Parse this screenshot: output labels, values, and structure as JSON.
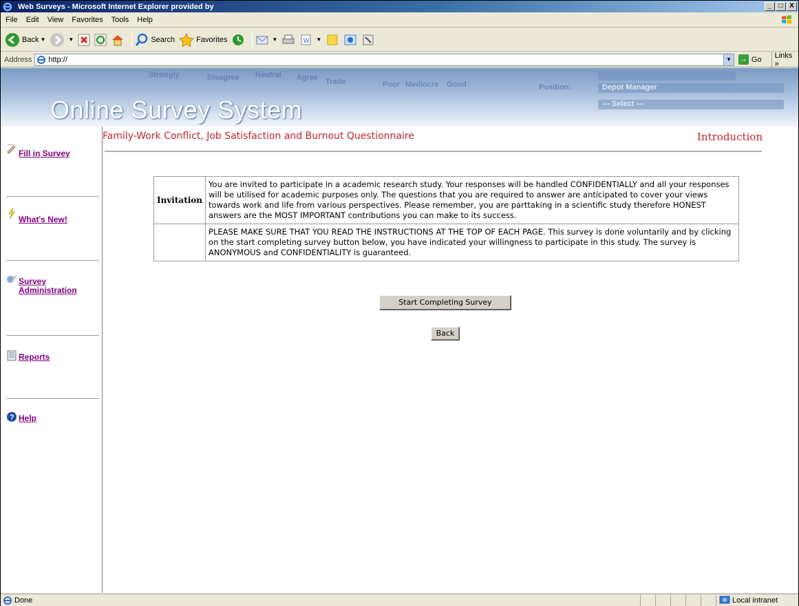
{
  "window": {
    "title": "Web Surveys - Microsoft Internet Explorer provided by",
    "controls": [
      "_",
      "□",
      "X"
    ]
  },
  "menubar": {
    "items": [
      "File",
      "Edit",
      "View",
      "Favorites",
      "Tools",
      "Help"
    ]
  },
  "toolbar": {
    "back_label": "Back",
    "search_label": "Search",
    "favorites_label": "Favorites"
  },
  "addressbar": {
    "label": "Address",
    "url": "http://",
    "go_label": "Go",
    "links_label": "Links »"
  },
  "banner": {
    "title": "Online Survey System",
    "ghost_texts": [
      "Strongly",
      "Disagree",
      "Neutral",
      "Agree",
      "Trade",
      "Poor",
      "Mediocre",
      "Good",
      "Position:",
      "Depot Manager",
      "--- Select ---"
    ]
  },
  "sidebar": {
    "items": [
      {
        "label": "Fill in Survey",
        "icon": "pencil-icon"
      },
      {
        "label": "What's New!",
        "icon": "lightning-icon"
      },
      {
        "label": "Survey Administration",
        "icon": "admin-icon"
      },
      {
        "label": "Reports",
        "icon": "report-icon"
      },
      {
        "label": "Help",
        "icon": "help-icon"
      }
    ]
  },
  "main": {
    "survey_title": "Family-Work Conflict, Job Satisfaction and Burnout Questionnaire",
    "section_title": "Introduction",
    "table": {
      "row1_label": "Invitation",
      "row1_text": "You are invited to participate in a academic research study. Your responses will be handled CONFIDENTIALLY and all your responses will be utilised for academic purposes only. The questions that you are required to answer are anticipated to cover your views towards work and life from various perspectives. Please remember, you are parttaking in a scientific study therefore HONEST answers are the MOST IMPORTANT contributions you can make to its success.",
      "row2_label": "",
      "row2_text": "PLEASE MAKE SURE THAT YOU READ THE INSTRUCTIONS AT THE TOP OF EACH PAGE. This survey is done voluntarily and by clicking on the start completing survey button below, you have indicated your willingness to participate in this study. The survey is ANONYMOUS and CONFIDENTIALITY is guaranteed."
    },
    "start_button": "Start Completing Survey",
    "back_button": "Back"
  },
  "statusbar": {
    "status": "Done",
    "zone": "Local intranet"
  },
  "colors": {
    "accent_red": "#c0272d",
    "link_purple": "#800080",
    "titlebar_blue": "#0a246a"
  }
}
